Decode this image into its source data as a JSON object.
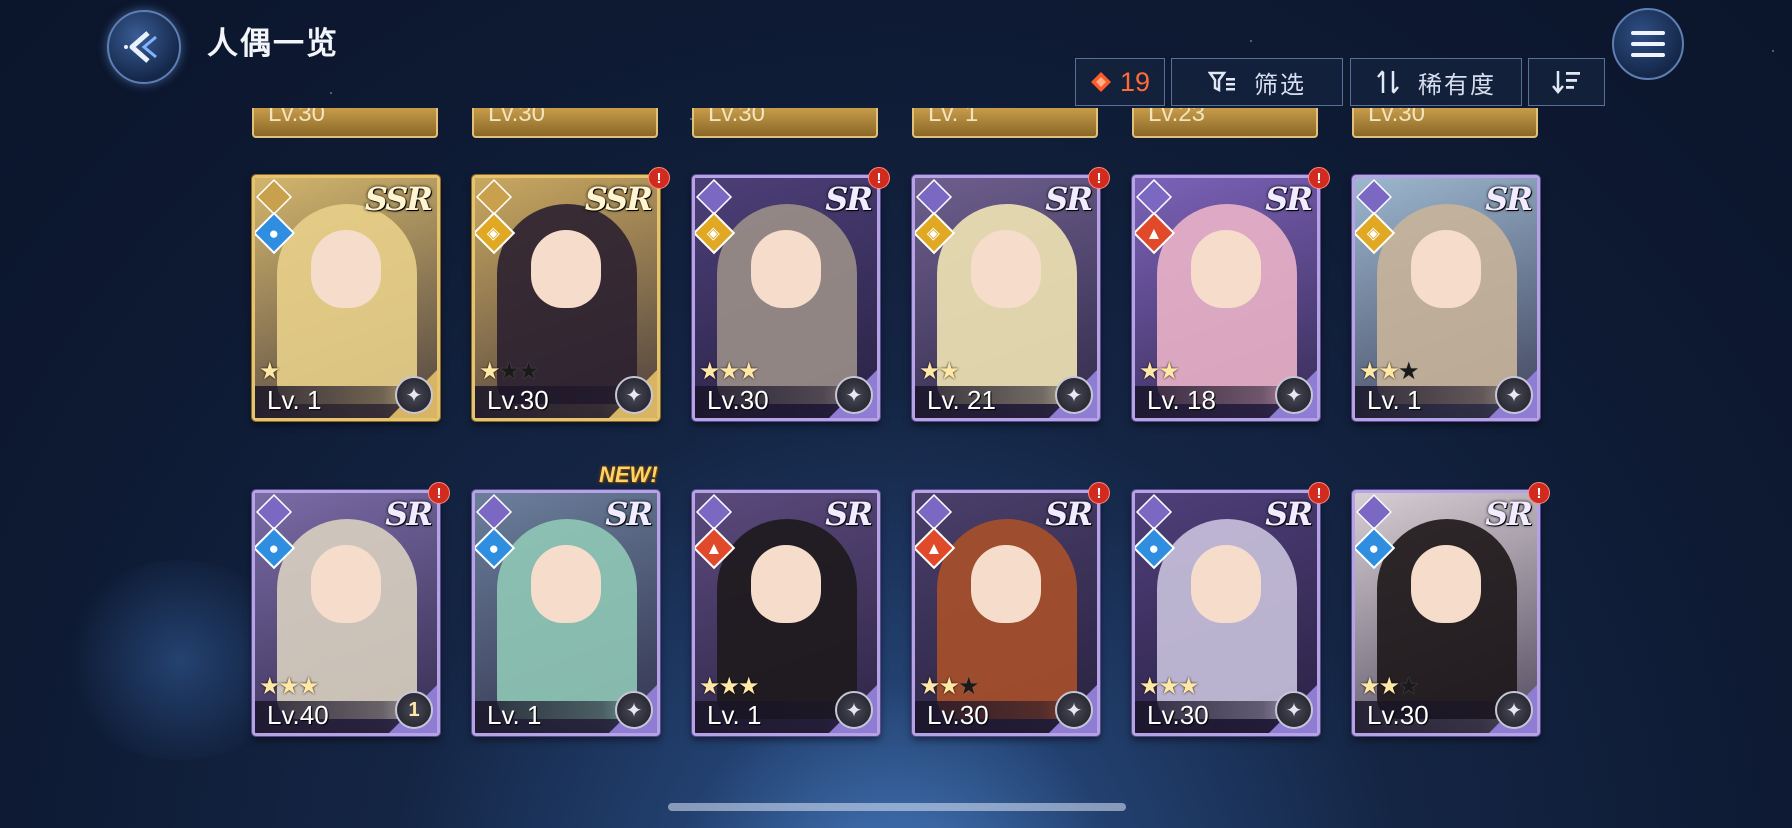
{
  "header": {
    "title": "人偶一览"
  },
  "toolbar": {
    "gem_count": "19",
    "filter_label": "筛选",
    "rarity_label": "稀有度"
  },
  "partial_row": [
    {
      "level": "Lv.30"
    },
    {
      "level": "Lv.30"
    },
    {
      "level": "Lv.30"
    },
    {
      "level": "Lv. 1"
    },
    {
      "level": "Lv.23"
    },
    {
      "level": "Lv.30"
    }
  ],
  "cards": [
    {
      "rarity": "SSR",
      "level": "Lv. 1",
      "stars_on": 1,
      "stars_off": 0,
      "element": "water",
      "alert": false,
      "new": false,
      "hair": "#e8cf8a",
      "bg": "#d2b56c"
    },
    {
      "rarity": "SSR",
      "level": "Lv.30",
      "stars_on": 1,
      "stars_off": 2,
      "element": "light",
      "alert": true,
      "new": false,
      "hair": "#2b2030",
      "bg": "#c9a860"
    },
    {
      "rarity": "SR",
      "level": "Lv.30",
      "stars_on": 3,
      "stars_off": 0,
      "element": "light",
      "alert": true,
      "new": false,
      "hair": "#9b8f88",
      "bg": "#4c3f78"
    },
    {
      "rarity": "SR",
      "level": "Lv. 21",
      "stars_on": 2,
      "stars_off": 0,
      "element": "light",
      "alert": true,
      "new": false,
      "hair": "#efe4b4",
      "bg": "#6d5f8e"
    },
    {
      "rarity": "SR",
      "level": "Lv. 18",
      "stars_on": 2,
      "stars_off": 0,
      "element": "fire",
      "alert": true,
      "new": false,
      "hair": "#eab2c8",
      "bg": "#7c62b8"
    },
    {
      "rarity": "SR",
      "level": "Lv. 1",
      "stars_on": 2,
      "stars_off": 1,
      "element": "light",
      "alert": false,
      "new": false,
      "hair": "#c8b49a",
      "bg": "#9cb7cf"
    },
    {
      "rarity": "SR",
      "level": "Lv.40",
      "stars_on": 3,
      "stars_off": 0,
      "element": "water",
      "alert": true,
      "new": false,
      "hair": "#d8cfc0",
      "bg": "#7a6ba6"
    },
    {
      "rarity": "SR",
      "level": "Lv. 1",
      "stars_on": 0,
      "stars_off": 0,
      "element": "water",
      "alert": false,
      "new": true,
      "hair": "#8fc8b6",
      "bg": "#6b7f9c"
    },
    {
      "rarity": "SR",
      "level": "Lv. 1",
      "stars_on": 3,
      "stars_off": 0,
      "element": "fire",
      "alert": false,
      "new": false,
      "hair": "#1d1a1c",
      "bg": "#5b4a7d"
    },
    {
      "rarity": "SR",
      "level": "Lv.30",
      "stars_on": 2,
      "stars_off": 1,
      "element": "fire",
      "alert": true,
      "new": false,
      "hair": "#a9502a",
      "bg": "#4a3f6a"
    },
    {
      "rarity": "SR",
      "level": "Lv.30",
      "stars_on": 3,
      "stars_off": 0,
      "element": "water",
      "alert": true,
      "new": false,
      "hair": "#c9c2dd",
      "bg": "#4f3f7a"
    },
    {
      "rarity": "SR",
      "level": "Lv.30",
      "stars_on": 2,
      "stars_off": 1,
      "element": "water",
      "alert": true,
      "new": false,
      "hair": "#1c1618",
      "bg": "#d8cfd4"
    }
  ],
  "new_label": "NEW!",
  "emblem_special": {
    "index": 6,
    "text": "1"
  },
  "colors": {
    "ssr_border": "#e6c46e",
    "sr_border": "#b6a3e6",
    "gem": "#ff6a3a",
    "alert": "#d12a1f"
  }
}
